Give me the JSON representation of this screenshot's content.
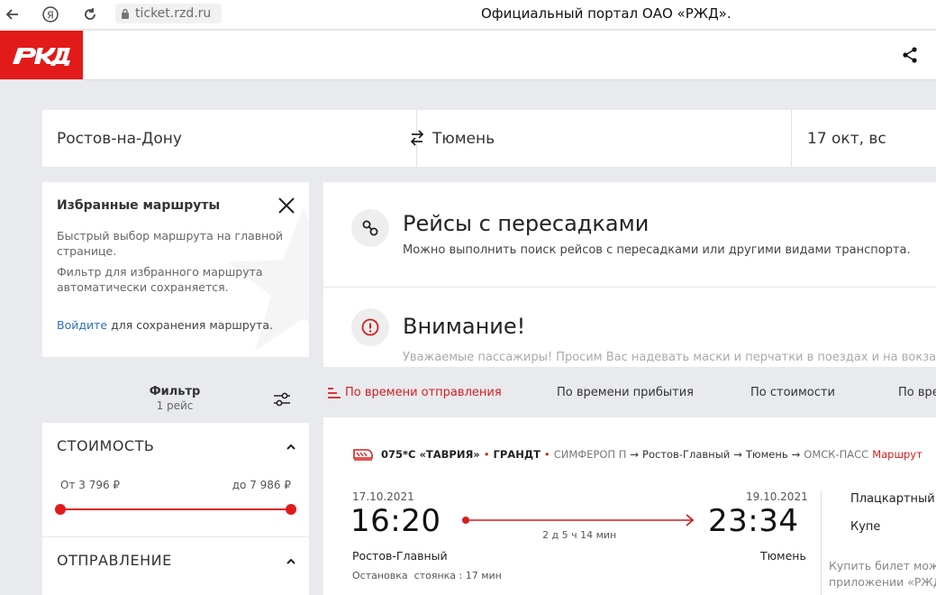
{
  "browser": {
    "url": "ticket.rzd.ru",
    "page_title": "Официальный портал ОАО «РЖД»."
  },
  "search": {
    "from": "Ростов-на-Дону",
    "to": "Тюмень",
    "date": "17 окт, вс"
  },
  "favorites": {
    "title": "Избранные маршруты",
    "text1": "Быстрый выбор маршрута на главной странице.",
    "text2": "Фильтр для избранного маршрута автоматически сохраняется.",
    "login_link": "Войдите",
    "login_rest": " для сохранения маршрута."
  },
  "transfers": {
    "title": "Рейсы с пересадками",
    "text": "Можно выполнить поиск рейсов с пересадками или другими видами транспорта."
  },
  "attention": {
    "title": "Внимание!",
    "text": "Уважаемые пассажиры! Просим Вас надевать маски и перчатки в поездах и на вокзалах."
  },
  "filter": {
    "label": "Фильтр",
    "count": "1 рейс"
  },
  "sort": {
    "departure": "По времени отправления",
    "arrival": "По времени прибытия",
    "price": "По стоимости",
    "duration": "По вре"
  },
  "price_filter": {
    "title": "СТОИМОСТЬ",
    "from": "От 3 796 ₽",
    "to": "до 7 986 ₽"
  },
  "departure_filter": {
    "title": "ОТПРАВЛЕНИЕ"
  },
  "train": {
    "number": "075*С «ТАВРИЯ»",
    "brand": "ГРАНДТ",
    "origin": "СИМФЕРОП П",
    "stop_a": "Ростов-Главный",
    "stop_b": "Тюмень",
    "destination": "ОМСК-ПАСС",
    "route_link": "Маршрут",
    "dep_date": "17.10.2021",
    "arr_date": "19.10.2021",
    "dep_time": "16:20",
    "arr_time": "23:34",
    "duration": "2 д 5 ч 14 мин",
    "dep_station": "Ростов-Главный",
    "arr_station": "Тюмень",
    "stop_label": "Остановка",
    "stop_value": "стоянка : 17 мин",
    "car_1": "Плацкартный",
    "car_2": "Купе",
    "buy_note_1": "Купить билет мож",
    "buy_note_2": "приложении «РЖД"
  }
}
